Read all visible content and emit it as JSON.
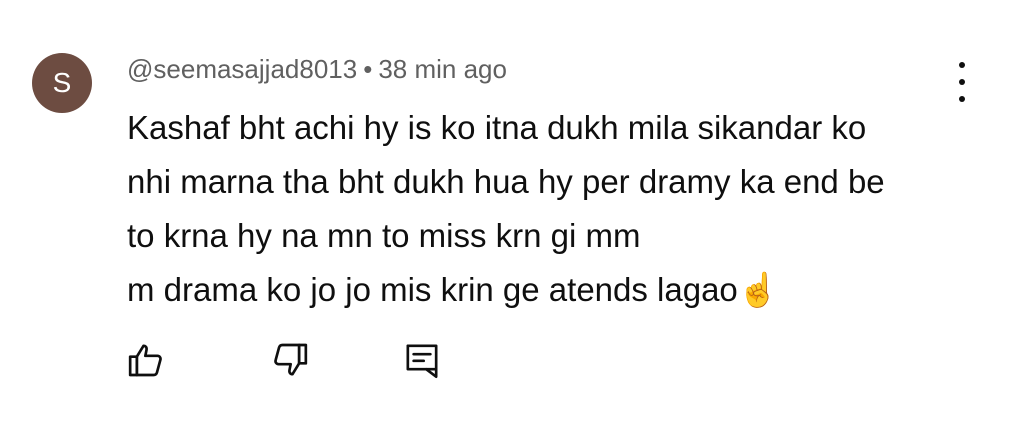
{
  "comment": {
    "avatar_letter": "S",
    "avatar_color": "#6d4c41",
    "author": "@seemasajjad8013",
    "separator": "•",
    "timestamp": "38 min ago",
    "text_lines": [
      "Kashaf bht achi hy is ko itna dukh mila sikandar ko",
      "nhi marna tha bht dukh hua hy per dramy ka end be",
      "to krna hy na mn to miss krn gi mm",
      "m drama ko jo jo mis krin ge atends lagao"
    ],
    "emoji": "☝️"
  },
  "actions": {
    "like_icon": "thumbs-up-icon",
    "dislike_icon": "thumbs-down-icon",
    "reply_icon": "reply-comment-icon",
    "menu_icon": "more-vert-icon"
  }
}
